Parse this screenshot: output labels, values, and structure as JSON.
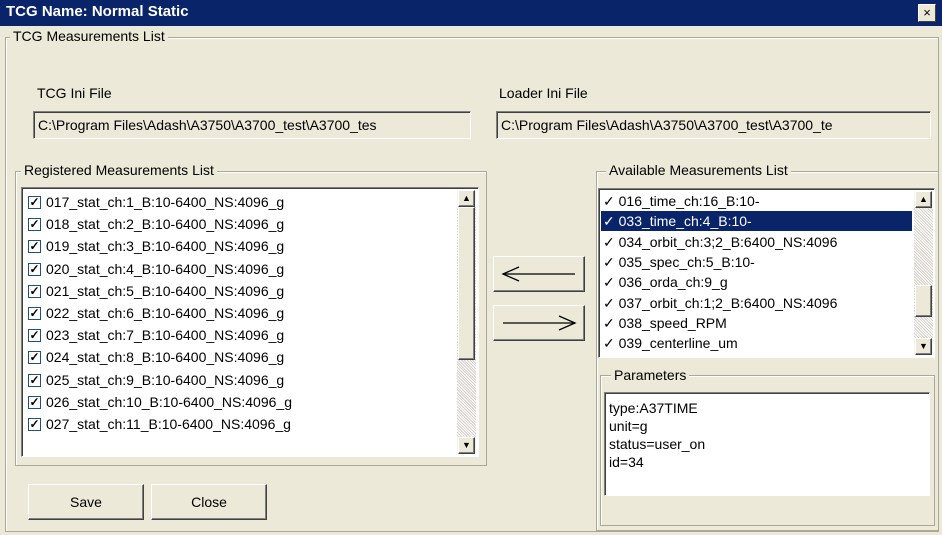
{
  "window": {
    "title": "TCG Name: Normal Static",
    "close_glyph": "×"
  },
  "outer_group": {
    "legend": "TCG Measurements List"
  },
  "tcg_ini": {
    "label": "TCG Ini File",
    "value": "C:\\Program Files\\Adash\\A3750\\A3700_test\\A3700_tes"
  },
  "loader_ini": {
    "label": "Loader Ini File",
    "value": "C:\\Program Files\\Adash\\A3750\\A3700_test\\A3700_te"
  },
  "registered": {
    "legend": "Registered Measurements List",
    "items": [
      "017_stat_ch:1_B:10-6400_NS:4096_g",
      "018_stat_ch:2_B:10-6400_NS:4096_g",
      "019_stat_ch:3_B:10-6400_NS:4096_g",
      "020_stat_ch:4_B:10-6400_NS:4096_g",
      "021_stat_ch:5_B:10-6400_NS:4096_g",
      "022_stat_ch:6_B:10-6400_NS:4096_g",
      "023_stat_ch:7_B:10-6400_NS:4096_g",
      "024_stat_ch:8_B:10-6400_NS:4096_g",
      "025_stat_ch:9_B:10-6400_NS:4096_g",
      "026_stat_ch:10_B:10-6400_NS:4096_g",
      "027_stat_ch:11_B:10-6400_NS:4096_g"
    ],
    "check_glyph": "✓"
  },
  "available": {
    "legend": "Available Measurements List",
    "items": [
      "✓ 016_time_ch:16_B:10-",
      "✓ 033_time_ch:4_B:10-",
      "✓ 034_orbit_ch:3;2_B:6400_NS:4096",
      "✓ 035_spec_ch:5_B:10-",
      "✓ 036_orda_ch:9_g",
      "✓ 037_orbit_ch:1;2_B:6400_NS:4096",
      "✓ 038_speed_RPM",
      "✓ 039_centerline_um"
    ],
    "selected_index": 1
  },
  "parameters": {
    "legend": "Parameters",
    "lines": [
      "type:A37TIME",
      "unit=g",
      "status=user_on",
      "id=34"
    ]
  },
  "buttons": {
    "save": "Save",
    "close": "Close"
  },
  "scroll_arrows": {
    "up": "▲",
    "down": "▼"
  },
  "colors": {
    "title_bar": "#0a246a",
    "selection": "#0a246a",
    "face": "#ece9d8"
  }
}
